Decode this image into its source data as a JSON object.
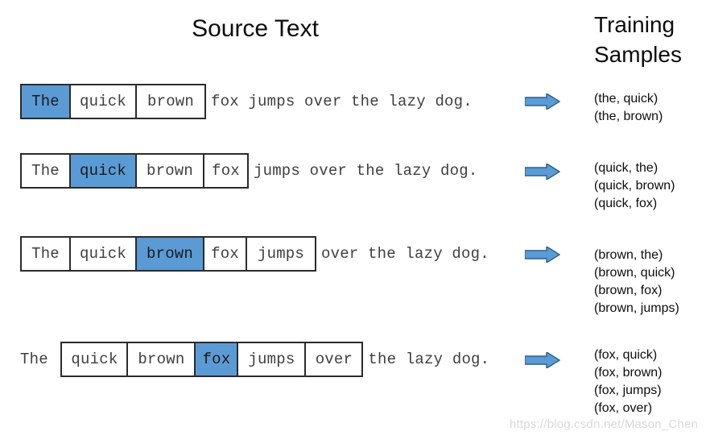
{
  "headings": {
    "source_text": "Source Text",
    "training_line1": "Training",
    "training_line2": "Samples"
  },
  "sentence": "The quick brown fox jumps over the lazy dog.",
  "rows": [
    {
      "focus_word": "The",
      "prefix": "",
      "cells": [
        "The",
        "quick",
        "brown"
      ],
      "focus_index": 0,
      "suffix": "fox jumps over the lazy dog.",
      "samples": [
        "(the, quick)",
        "(the, brown)"
      ]
    },
    {
      "focus_word": "quick",
      "prefix": "",
      "cells": [
        "The",
        "quick",
        "brown",
        "fox"
      ],
      "focus_index": 1,
      "suffix": "jumps over the lazy dog.",
      "samples": [
        "(quick, the)",
        "(quick, brown)",
        "(quick, fox)"
      ]
    },
    {
      "focus_word": "brown",
      "prefix": "",
      "cells": [
        "The",
        "quick",
        "brown",
        "fox",
        "jumps"
      ],
      "focus_index": 2,
      "suffix": "over the lazy dog.",
      "samples": [
        "(brown, the)",
        "(brown, quick)",
        "(brown, fox)",
        "(brown, jumps)"
      ]
    },
    {
      "focus_word": "fox",
      "prefix": "The ",
      "cells": [
        "quick",
        "brown",
        "fox",
        "jumps",
        "over"
      ],
      "focus_index": 2,
      "suffix": "the lazy dog.",
      "samples": [
        "(fox, quick)",
        "(fox, brown)",
        "(fox, jumps)",
        "(fox, over)"
      ]
    }
  ],
  "arrow_icon": "right-arrow-icon",
  "colors": {
    "highlight": "#5B9BD5",
    "arrow_fill": "#5B9BD5",
    "arrow_stroke": "#2E5F8A",
    "box_border": "#2B2B2B",
    "text": "#3F3F3F"
  },
  "watermark": "https://blog.csdn.net/Mason_Chen"
}
